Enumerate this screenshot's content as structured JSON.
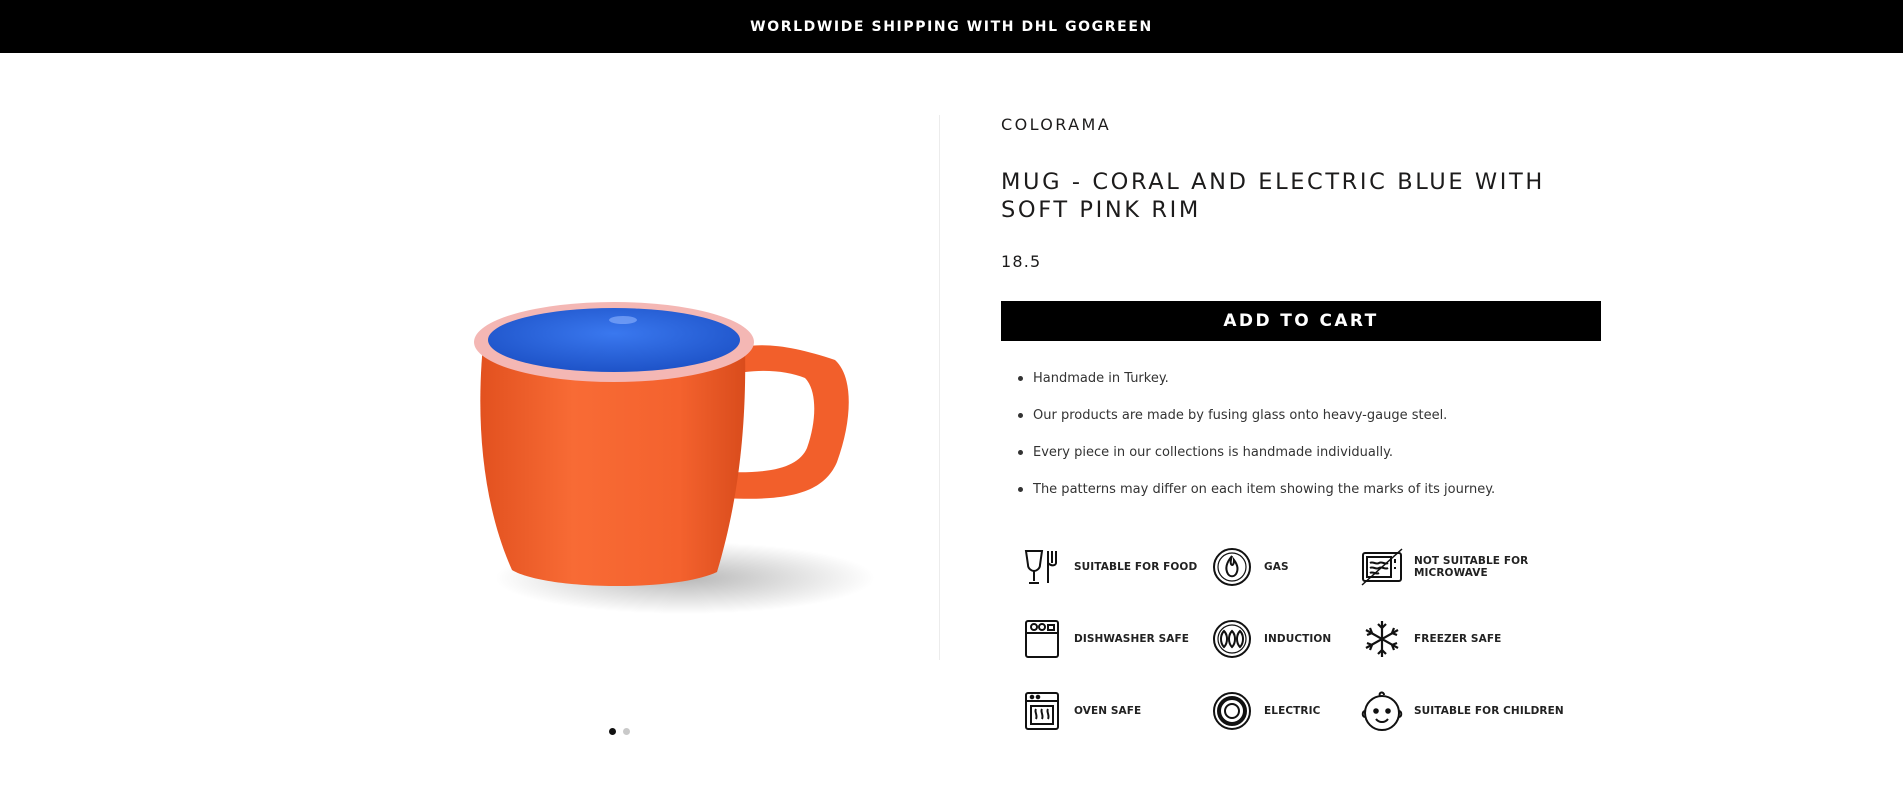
{
  "announcement": {
    "text": "WORLDWIDE SHIPPING WITH DHL GOGREEN"
  },
  "gallery": {
    "image_alt": "Coral enamel mug with electric blue interior and soft pink rim",
    "slide_count": 2,
    "active_slide": 1
  },
  "product": {
    "vendor": "COLORAMA",
    "title": "MUG - CORAL AND ELECTRIC BLUE WITH SOFT PINK RIM",
    "price": "18.5",
    "add_to_cart_label": "ADD TO CART",
    "features": [
      "Handmade in Turkey.",
      "Our products are made by fusing glass onto heavy-gauge steel.",
      "Every piece in our collections is handmade individually.",
      "The patterns may differ on each item showing the marks of its journey."
    ]
  },
  "care_icons": [
    {
      "icon": "cutlery-icon",
      "label": "SUITABLE FOR FOOD"
    },
    {
      "icon": "gas-flame-icon",
      "label": "GAS"
    },
    {
      "icon": "microwave-icon",
      "label": "NOT SUITABLE FOR MICROWAVE"
    },
    {
      "icon": "dishwasher-icon",
      "label": "DISHWASHER SAFE"
    },
    {
      "icon": "induction-icon",
      "label": "INDUCTION"
    },
    {
      "icon": "snowflake-icon",
      "label": "FREEZER SAFE"
    },
    {
      "icon": "oven-icon",
      "label": "OVEN SAFE"
    },
    {
      "icon": "electric-hob-icon",
      "label": "ELECTRIC"
    },
    {
      "icon": "baby-face-icon",
      "label": "SUITABLE FOR CHILDREN"
    }
  ],
  "colors": {
    "announcement_bg": "#000000",
    "cart_button_bg": "#000000",
    "mug_body": "#f4622e",
    "mug_interior": "#2f67e0",
    "mug_rim": "#f4b7b4"
  }
}
